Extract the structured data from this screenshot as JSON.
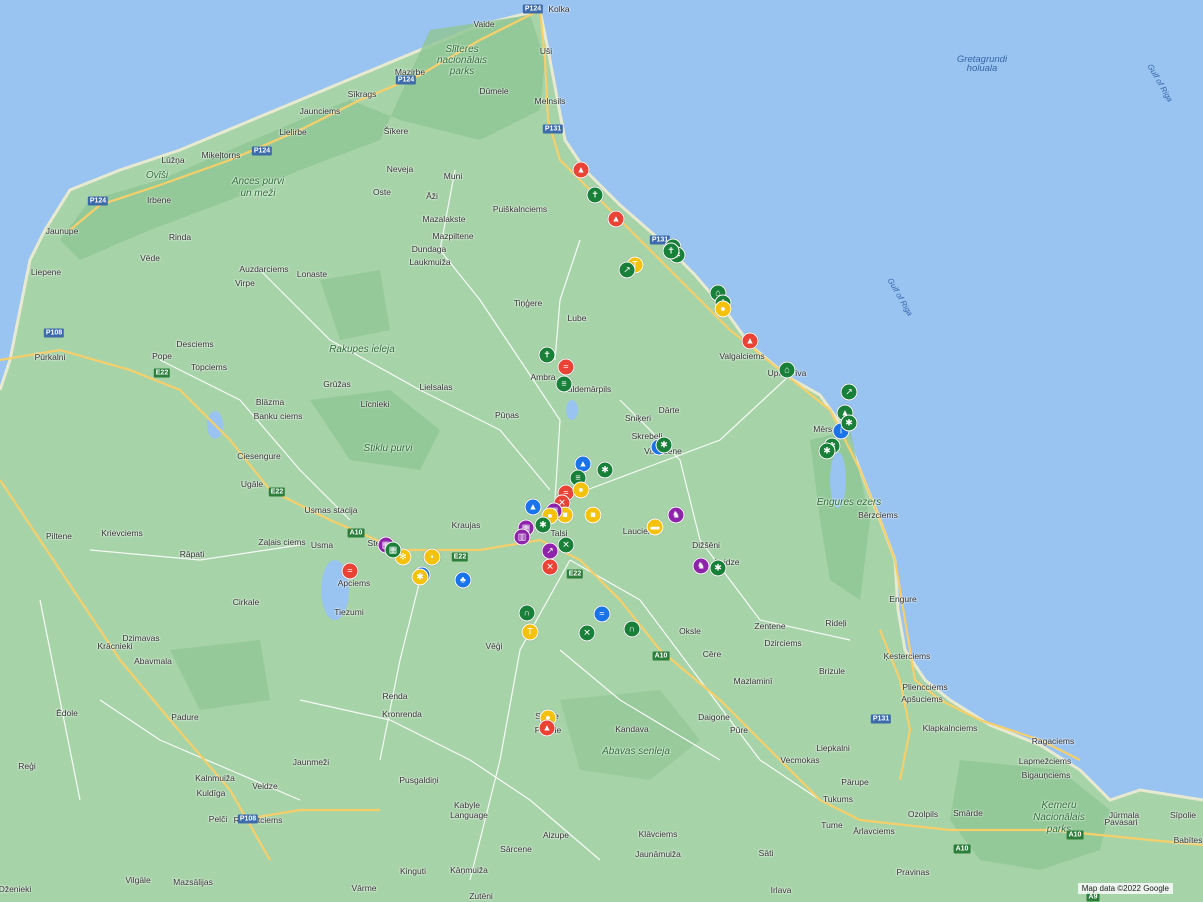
{
  "attribution": "Map data ©2022 Google",
  "colors": {
    "sea": "#99c3f0",
    "land": "#a7d3a9",
    "park": "#8ec593",
    "road_major": "#f6cf6b",
    "road_minor": "#ffffff",
    "pin_green": "#188038",
    "pin_red": "#ea4335",
    "pin_yellow": "#f4c20d",
    "pin_blue": "#1a73e8",
    "pin_purple": "#8e24aa"
  },
  "places": [
    "Vaide",
    "Kolka",
    "Slīteres",
    "nacionālais",
    "parks",
    "Uši",
    "Mazirbe",
    "Sīkrags",
    "Jaunciems",
    "Dūmele",
    "Melnsils",
    "Šīkere",
    "Lielirbe",
    "Lūžņa",
    "Miķeļtorņs",
    "Ovīši",
    "Ances purvi",
    "un meži",
    "Irbene",
    "Oste",
    "Neveja",
    "Muni",
    "Āži",
    "Mazalakste",
    "Puiškalnciems",
    "Mazpiltene",
    "Dundaga",
    "Laukmuiža",
    "Jaunupe",
    "Rinda",
    "Vēde",
    "Auzdarciems",
    "Lonaste",
    "Virpe",
    "Tiņģere",
    "Liepene",
    "Lube",
    "Pūrkalni",
    "Pope",
    "Desciems",
    "Topciems",
    "Rakupes ieleja",
    "Grūžas",
    "Lielsalas",
    "Ambra",
    "Valdemārpils",
    "Valgalciems",
    "Upesgrīva",
    "Blāzma",
    "Banku ciems",
    "Līcnieki",
    "Pūņas",
    "Sniķeri",
    "Dārte",
    "Skrebeļi",
    "Vandzene",
    "Mērsrags",
    "Ciesengure",
    "Stiklu purvi",
    "Ugāle",
    "Usmas stacija",
    "Kraujas",
    "Talsi",
    "Usma",
    "Zaļais ciems",
    "Stende",
    "Krievciems",
    "Rāpati",
    "Piltene",
    "Apciems",
    "Lauciene",
    "Dižšēni",
    "Laidze",
    "Engures ezers",
    "Bērzciems",
    "Sabile",
    "Tiezumi",
    "Cirkale",
    "Dzimavas",
    "Krācnieki",
    "Engure",
    "Abavmala",
    "Rideļi",
    "Zentene",
    "Dzirciems",
    "Cēre",
    "Oksle",
    "Ķesterciems",
    "Brizule",
    "Vēģi",
    "Renda",
    "Kronrenda",
    "Pliencciems",
    "Apšuciems",
    "Mazlaminī",
    "Padure",
    "Pūre",
    "Daigone",
    "Kandava",
    "Pedele",
    "Abavas senleja",
    "Klapkalnciems",
    "Ragaciems",
    "Jaunmeži",
    "Ēdole",
    "Reģi",
    "Vecmokas",
    "Liepkalni",
    "Lapmežciems",
    "Bigauņciems",
    "Kalnmuiža",
    "Veldze",
    "Pusgaldiņi",
    "Kuldīga",
    "Tukums",
    "Pārupe",
    "Smārde",
    "Ķemeru",
    "Nacionālais",
    "parks",
    "Jūrmala",
    "Sīpolie",
    "Kabyle",
    "Language",
    "Aizupe",
    "Tume",
    "Ozolpils",
    "Klāvciems",
    "Ārlavciems",
    "Pavasari",
    "Pelči",
    "Rimzātciems",
    "Sārcene",
    "Jaunāmuiža",
    "Sāti",
    "Pravinas",
    "Vilgāle",
    "Mazsālijas",
    "Kinguti",
    "Kāņmuiža",
    "Vārme",
    "Zutēni",
    "Irlava",
    "Dženieki",
    "Gretagrundi",
    "holuala",
    "Gulf of Riga",
    "Gulf of Riga",
    "Babītes"
  ],
  "road_numbers": [
    "P124",
    "P124",
    "P124",
    "P124",
    "P131",
    "P131",
    "E22",
    "E22",
    "E22",
    "A10",
    "A10",
    "A10",
    "A10",
    "P108",
    "P108",
    "P131",
    "A9",
    "E22"
  ],
  "markers": [
    {
      "color": "red",
      "icon": "campfire-icon",
      "glyph": "▲"
    },
    {
      "color": "green",
      "icon": "church-icon",
      "glyph": "✝"
    },
    {
      "color": "red",
      "icon": "campfire-icon",
      "glyph": "▲"
    },
    {
      "color": "green",
      "icon": "church-icon",
      "glyph": "✝"
    },
    {
      "color": "green",
      "icon": "nature-icon",
      "glyph": "✱"
    },
    {
      "color": "green",
      "icon": "church-icon",
      "glyph": "✝"
    },
    {
      "color": "yellow",
      "icon": "sightseeing-icon",
      "glyph": "T"
    },
    {
      "color": "green",
      "icon": "hiking-icon",
      "glyph": "↗"
    },
    {
      "color": "green",
      "icon": "shelter-icon",
      "glyph": "⌂"
    },
    {
      "color": "green",
      "icon": "church-icon",
      "glyph": "✝"
    },
    {
      "color": "yellow",
      "icon": "sightseeing-icon",
      "glyph": "●"
    },
    {
      "color": "red",
      "icon": "campfire-icon",
      "glyph": "▲"
    },
    {
      "color": "green",
      "icon": "home-icon",
      "glyph": "⌂"
    },
    {
      "color": "green",
      "icon": "hiking-icon",
      "glyph": "↗"
    },
    {
      "color": "green",
      "icon": "education-icon",
      "glyph": "▲"
    },
    {
      "color": "blue",
      "icon": "info-icon",
      "glyph": "i"
    },
    {
      "color": "green",
      "icon": "nature-icon",
      "glyph": "✱"
    },
    {
      "color": "green",
      "icon": "nature-icon",
      "glyph": "✱"
    },
    {
      "color": "green",
      "icon": "nature-icon",
      "glyph": "✱"
    },
    {
      "color": "green",
      "icon": "church-icon",
      "glyph": "✝"
    },
    {
      "color": "red",
      "icon": "swimming-icon",
      "glyph": "≈"
    },
    {
      "color": "green",
      "icon": "park-icon",
      "glyph": "≡"
    },
    {
      "color": "blue",
      "icon": "like-icon",
      "glyph": "▲"
    },
    {
      "color": "green",
      "icon": "nature-icon",
      "glyph": "✱"
    },
    {
      "color": "blue",
      "icon": "info-icon",
      "glyph": "i"
    },
    {
      "color": "green",
      "icon": "nature-icon",
      "glyph": "✱"
    },
    {
      "color": "green",
      "icon": "park-icon",
      "glyph": "≡"
    },
    {
      "color": "red",
      "icon": "swimming-icon",
      "glyph": "≈"
    },
    {
      "color": "yellow",
      "icon": "sightseeing-icon",
      "glyph": "●"
    },
    {
      "color": "blue",
      "icon": "like-icon",
      "glyph": "▲"
    },
    {
      "color": "red",
      "icon": "food-icon",
      "glyph": "✕"
    },
    {
      "color": "yellow",
      "icon": "shopping-icon",
      "glyph": "■"
    },
    {
      "color": "purple",
      "icon": "museum-icon",
      "glyph": "▦"
    },
    {
      "color": "yellow",
      "icon": "sightseeing-icon",
      "glyph": "●"
    },
    {
      "color": "yellow",
      "icon": "shopping-icon",
      "glyph": "■"
    },
    {
      "color": "purple",
      "icon": "museum-icon",
      "glyph": "▦"
    },
    {
      "color": "purple",
      "icon": "map-icon",
      "glyph": "▥"
    },
    {
      "color": "green",
      "icon": "nature-icon",
      "glyph": "✱"
    },
    {
      "color": "green",
      "icon": "sports-icon",
      "glyph": "✕"
    },
    {
      "color": "purple",
      "icon": "hiking-icon",
      "glyph": "↗"
    },
    {
      "color": "red",
      "icon": "food-icon",
      "glyph": "✕"
    },
    {
      "color": "yellow",
      "icon": "attraction-icon",
      "glyph": "✻"
    },
    {
      "color": "yellow",
      "icon": "ticket-icon",
      "glyph": "▬"
    },
    {
      "color": "purple",
      "icon": "horse-icon",
      "glyph": "♞"
    },
    {
      "color": "purple",
      "icon": "horse-icon",
      "glyph": "♞"
    },
    {
      "color": "green",
      "icon": "nature-icon",
      "glyph": "✱"
    },
    {
      "color": "purple",
      "icon": "museum-icon",
      "glyph": "▦"
    },
    {
      "color": "green",
      "icon": "building-icon",
      "glyph": "▦"
    },
    {
      "color": "yellow",
      "icon": "sightseeing-icon",
      "glyph": "●"
    },
    {
      "color": "yellow",
      "icon": "chat-icon",
      "glyph": "▪"
    },
    {
      "color": "red",
      "icon": "swimming-icon",
      "glyph": "≈"
    },
    {
      "color": "blue",
      "icon": "farm-icon",
      "glyph": "✱"
    },
    {
      "color": "yellow",
      "icon": "farm-icon",
      "glyph": "✱"
    },
    {
      "color": "blue",
      "icon": "tree-icon",
      "glyph": "♣"
    },
    {
      "color": "green",
      "icon": "playground-icon",
      "glyph": "∩"
    },
    {
      "color": "yellow",
      "icon": "sightseeing-icon",
      "glyph": "T"
    },
    {
      "color": "blue",
      "icon": "swimming-icon",
      "glyph": "≈"
    },
    {
      "color": "green",
      "icon": "sports-icon",
      "glyph": "✕"
    },
    {
      "color": "green",
      "icon": "playground-icon",
      "glyph": "∩"
    },
    {
      "color": "yellow",
      "icon": "sightseeing-icon",
      "glyph": "●"
    },
    {
      "color": "red",
      "icon": "campfire-icon",
      "glyph": "▲"
    }
  ]
}
